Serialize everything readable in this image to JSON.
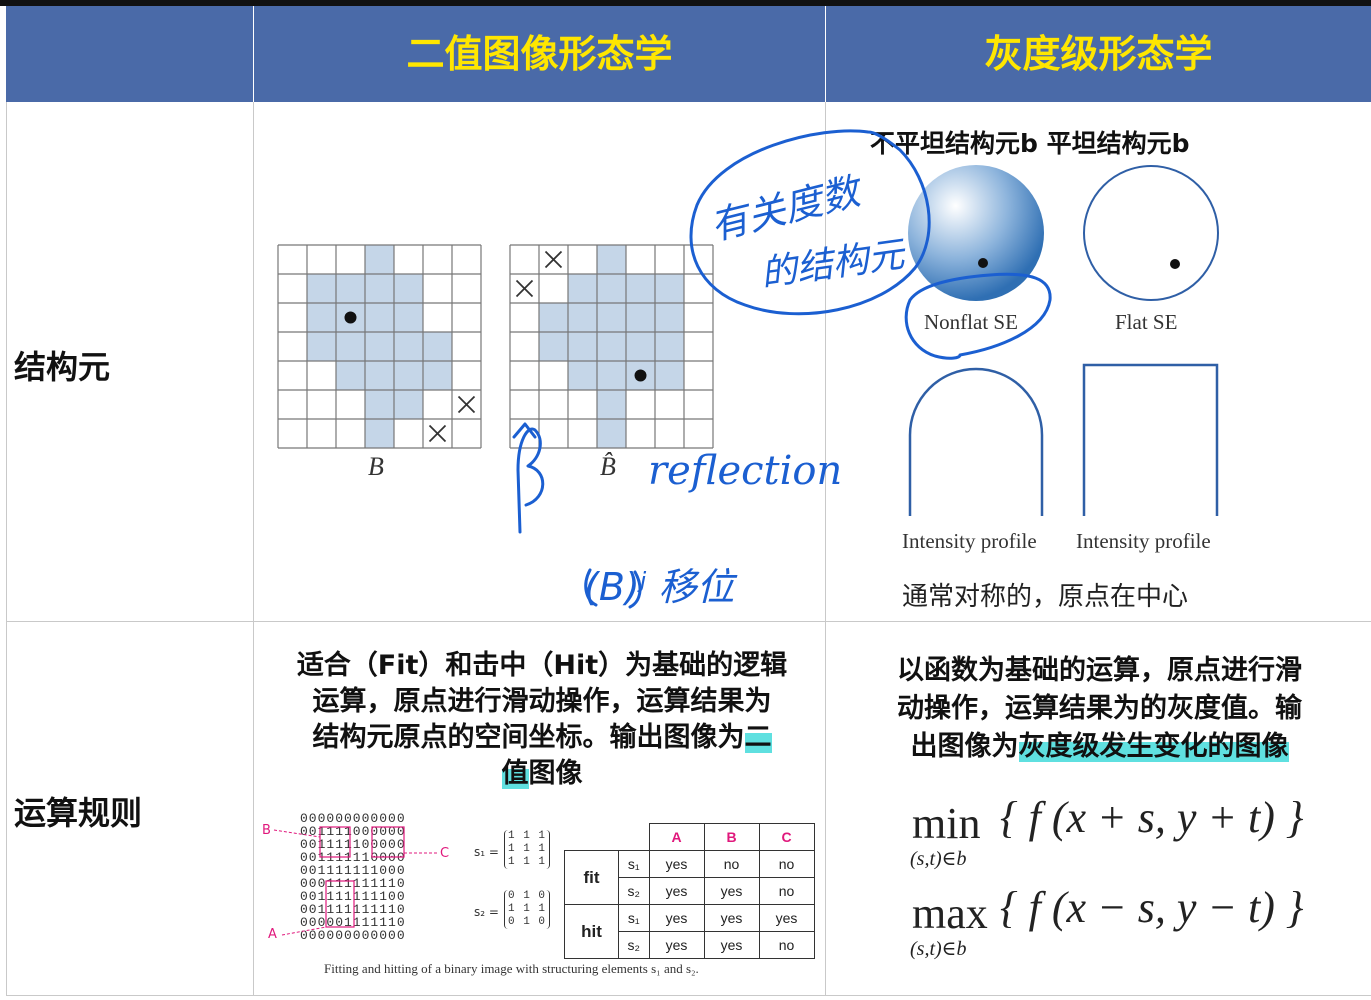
{
  "header": {
    "col_binary": "二值图像形态学",
    "col_gray": "灰度级形态学"
  },
  "rows": {
    "se_label": "结构元",
    "op_label": "运算规则"
  },
  "binary_se": {
    "label_B": "B",
    "label_Bhat": "B̂"
  },
  "gray_se": {
    "heading": "不平坦结构元b 平坦结构元b",
    "nonflat_label": "Nonflat SE",
    "flat_label": "Flat SE",
    "profile_left": "Intensity profile",
    "profile_right": "Intensity profile",
    "note": "通常对称的，原点在中心"
  },
  "handwriting": {
    "note1_line1": "有关度数",
    "note1_line2": "的结构元",
    "reflection": "reflection",
    "bhat_mark": "B̂",
    "note2": "(B)ʲ 移位"
  },
  "binary_op": {
    "desc_line1": "适合（Fit）和击中（Hit）为基础的逻辑",
    "desc_line2": "运算，原点进行滑动操作，运算结果为",
    "desc_line3": "结构元原点的空间坐标。输出图像为",
    "desc_hl1": "二",
    "desc_hl2": "值",
    "desc_line4_rest": "图像",
    "caption": "Fitting and hitting of a binary image with structuring elements s₁ and s₂.",
    "grid_rows": [
      "000000000000",
      "001111000000",
      "001111100000",
      "001111110000",
      "001111111000",
      "000111111110",
      "001111111100",
      "001111111110",
      "000001111110",
      "000000000000"
    ],
    "point_labels": [
      "B",
      "C",
      "A"
    ],
    "s1_label": "s₁ =",
    "s2_label": "s₂ =",
    "s1_rows": [
      "1 1 1",
      "1 1 1",
      "1 1 1"
    ],
    "s2_rows": [
      "0 1 0",
      "1 1 1",
      "0 1 0"
    ],
    "table": {
      "cols": [
        "A",
        "B",
        "C"
      ],
      "rows": [
        {
          "group": "fit",
          "se": "s₁",
          "vals": [
            "yes",
            "no",
            "no"
          ]
        },
        {
          "group": "",
          "se": "s₂",
          "vals": [
            "yes",
            "yes",
            "no"
          ]
        },
        {
          "group": "hit",
          "se": "s₁",
          "vals": [
            "yes",
            "yes",
            "yes"
          ]
        },
        {
          "group": "",
          "se": "s₂",
          "vals": [
            "yes",
            "yes",
            "no"
          ]
        }
      ]
    }
  },
  "gray_op": {
    "desc_line1": "以函数为基础的运算，原点进行滑",
    "desc_line2": "动操作，运算结果为的灰度值。输",
    "desc_line3_pre": "出图像为",
    "desc_line3_hl": "灰度级发生变化的图像",
    "min_word": "min",
    "max_word": "max",
    "sub": "(s,t)∈b",
    "min_expr": "{ f (x + s, y + t) }",
    "max_expr": "{ f (x − s, y − t) }"
  },
  "colors": {
    "header_bg": "#4a6aa8",
    "header_text": "#ffe600",
    "se_fill": "#c5d6e8",
    "ink": "#1b5fd1",
    "highlight": "#5fe0e0",
    "magenta": "#e0187c"
  }
}
